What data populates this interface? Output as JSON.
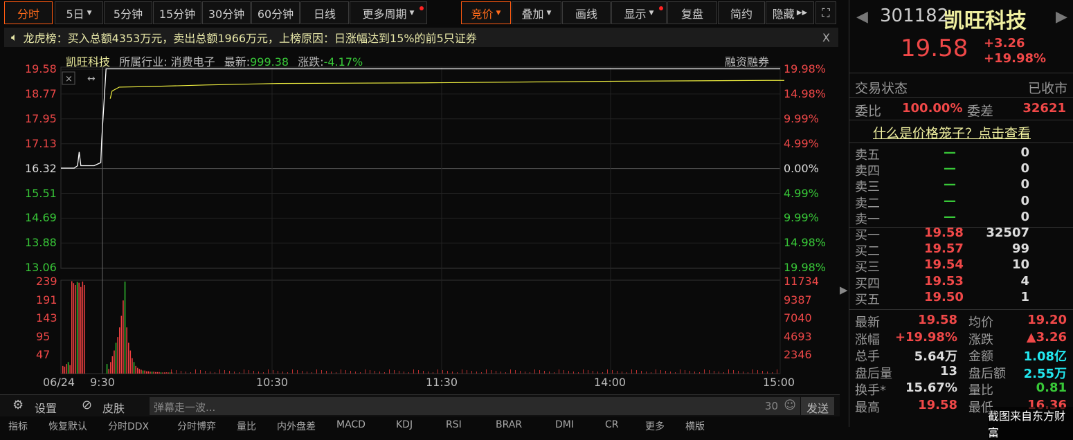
{
  "toolbar": {
    "left": [
      "分时",
      "5日",
      "5分钟",
      "15分钟",
      "30分钟",
      "60分钟",
      "日线",
      "更多周期"
    ],
    "right": [
      "竞价",
      "叠加",
      "画线",
      "显示",
      "复盘",
      "简约",
      "隐藏"
    ]
  },
  "notice": {
    "text": "龙虎榜：买入总额4353万元，卖出总额1966万元，上榜原因：日涨幅达到15%的前5只证券",
    "close": "X"
  },
  "chart_header": {
    "name": "凯旺科技",
    "industry_label": "所属行业:",
    "industry": "消费电子",
    "latest_label": "最新:",
    "latest": "999.38",
    "change_label": "涨跌:",
    "change": "-4.17%",
    "margin": "融资融券"
  },
  "chart_data": {
    "type": "line",
    "price_ticks": [
      "19.58",
      "18.77",
      "17.95",
      "17.13",
      "16.32",
      "15.51",
      "14.69",
      "13.88",
      "13.06"
    ],
    "pct_ticks": [
      "19.98%",
      "14.98%",
      "9.99%",
      "4.99%",
      "0.00%",
      "4.99%",
      "9.99%",
      "14.98%",
      "19.98%"
    ],
    "vol_ticks": [
      "239",
      "191",
      "143",
      "95",
      "47"
    ],
    "vol_right_ticks": [
      "11734",
      "9387",
      "7040",
      "4693",
      "2346"
    ],
    "x_ticks": [
      "06/24",
      "9:30",
      "10:30",
      "11:30",
      "14:00",
      "15:00"
    ],
    "ylim": [
      13.06,
      19.58
    ],
    "price_series": [
      [
        0,
        16.32
      ],
      [
        0.08,
        16.32
      ],
      [
        0.1,
        16.4
      ],
      [
        0.11,
        16.85
      ],
      [
        0.12,
        16.4
      ],
      [
        0.2,
        16.4
      ],
      [
        0.22,
        16.45
      ],
      [
        0.24,
        16.5
      ],
      [
        0.245,
        17.2
      ],
      [
        0.27,
        19.58
      ],
      [
        1,
        19.58
      ]
    ],
    "avg_series": [
      [
        0.27,
        18.6
      ],
      [
        0.28,
        18.85
      ],
      [
        0.32,
        18.98
      ],
      [
        0.5,
        19.0
      ],
      [
        0.8,
        19.05
      ],
      [
        1.2,
        19.1
      ],
      [
        2.0,
        19.12
      ],
      [
        3.0,
        19.17
      ],
      [
        3.9,
        19.2
      ],
      [
        4,
        19.2
      ]
    ],
    "volumes": [
      20,
      18,
      25,
      30,
      22,
      240,
      235,
      230,
      238,
      236,
      225,
      239,
      230,
      25,
      12,
      30,
      45,
      60,
      80,
      95,
      120,
      150,
      190,
      239,
      120,
      80,
      60,
      40,
      30,
      20,
      15,
      12,
      10,
      8,
      8,
      6,
      6,
      5,
      5,
      5,
      4,
      4,
      4,
      3,
      3,
      3,
      3,
      3,
      3,
      3
    ]
  },
  "bottom": {
    "settings": "设置",
    "skin": "皮肤",
    "danmu_placeholder": "弹幕走一波...",
    "count": "30",
    "send": "发送"
  },
  "bottom_tabs": [
    "指标",
    "恢复默认",
    "分时DDX",
    "分时博弈",
    "量比",
    "内外盘差",
    "MACD",
    "KDJ",
    "RSI",
    "BRAR",
    "DMI",
    "CR",
    "更多",
    "横版"
  ],
  "panel": {
    "code": "301182",
    "name": "凯旺科技",
    "price": "19.58",
    "change": "+3.26",
    "change_pct": "+19.98%",
    "status_label": "交易状态",
    "status": "已收市",
    "wb_label": "委比",
    "wb": "100.00%",
    "wc_label": "委差",
    "wc": "32621",
    "cage_link": "什么是价格笼子？点击查看",
    "asks": [
      {
        "label": "卖五",
        "price": "—",
        "vol": "0"
      },
      {
        "label": "卖四",
        "price": "—",
        "vol": "0"
      },
      {
        "label": "卖三",
        "price": "—",
        "vol": "0"
      },
      {
        "label": "卖二",
        "price": "—",
        "vol": "0"
      },
      {
        "label": "卖一",
        "price": "—",
        "vol": "0"
      }
    ],
    "bids": [
      {
        "label": "买一",
        "price": "19.58",
        "vol": "32507"
      },
      {
        "label": "买二",
        "price": "19.57",
        "vol": "99"
      },
      {
        "label": "买三",
        "price": "19.54",
        "vol": "10"
      },
      {
        "label": "买四",
        "price": "19.53",
        "vol": "4"
      },
      {
        "label": "买五",
        "price": "19.50",
        "vol": "1"
      }
    ],
    "stats": [
      {
        "l1": "最新",
        "v1": "19.58",
        "c1": "red",
        "l2": "均价",
        "v2": "19.20",
        "c2": "red"
      },
      {
        "l1": "涨幅",
        "v1": "+19.98%",
        "c1": "red",
        "l2": "涨跌",
        "v2": "▲3.26",
        "c2": "red"
      },
      {
        "l1": "总手",
        "v1": "5.64万",
        "c1": "white",
        "l2": "金额",
        "v2": "1.08亿",
        "c2": "cyan"
      },
      {
        "l1": "盘后量",
        "v1": "13",
        "c1": "white",
        "l2": "盘后额",
        "v2": "2.55万",
        "c2": "cyan"
      },
      {
        "l1": "换手*",
        "v1": "15.67%",
        "c1": "white",
        "l2": "量比",
        "v2": "0.81",
        "c2": "green"
      },
      {
        "l1": "最高",
        "v1": "19.58",
        "c1": "red",
        "l2": "最低",
        "v2": "16.36",
        "c2": "red"
      }
    ],
    "watermark": "截图来自东方财富"
  }
}
